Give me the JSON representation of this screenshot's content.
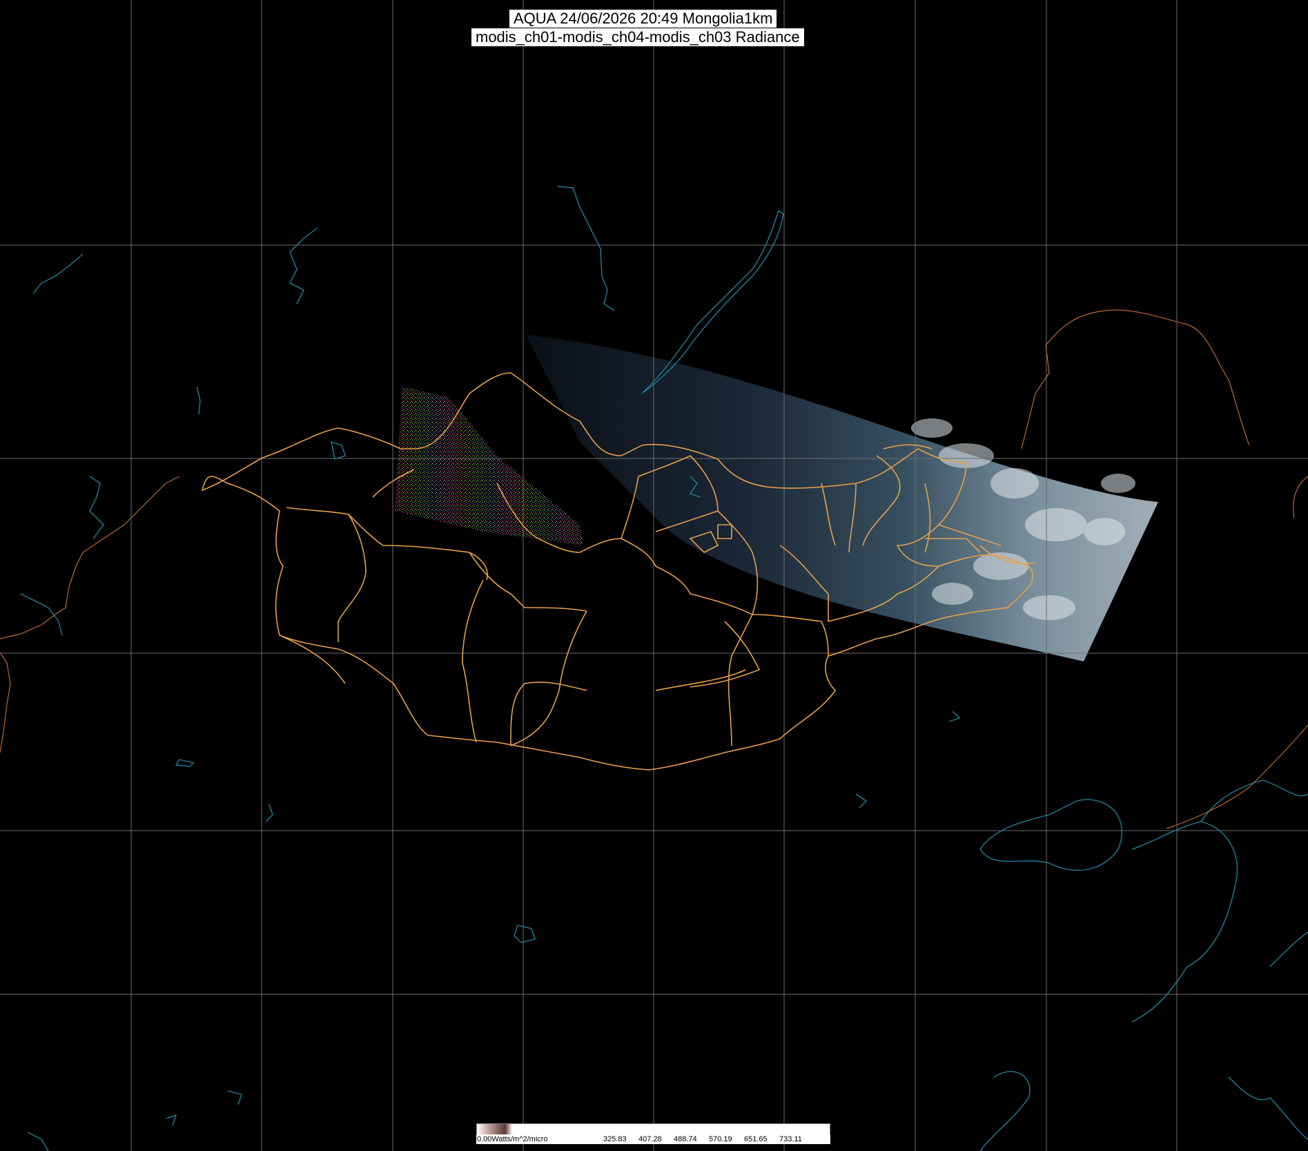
{
  "header": {
    "title_line1": "AQUA 24/06/2026 20:49 Mongolia1km",
    "title_line2": "modis_ch01-modis_ch04-modis_ch03 Radiance"
  },
  "colors": {
    "background": "#000000",
    "grid": "#6e6e6e",
    "coastline": "#1f7f99",
    "borders": "#e8a04a",
    "far_borders": "#b86a36"
  },
  "colorbar": {
    "labels": [
      "0.00Watts/m^2/micro",
      "325.83",
      "407.28",
      "488.74",
      "570.19",
      "651.65",
      "733.11"
    ]
  }
}
